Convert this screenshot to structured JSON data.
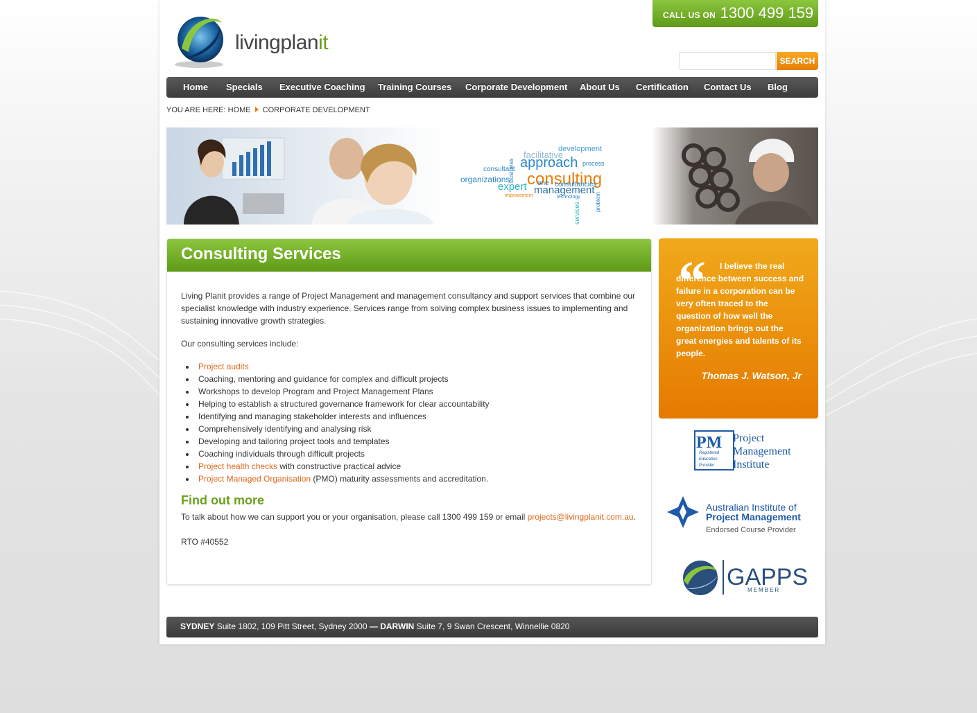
{
  "header": {
    "logo_text_main": "livingplan",
    "logo_text_accent": "it",
    "call_label": "CALL US ON",
    "call_number": "1300 499 159",
    "search_button": "SEARCH",
    "search_placeholder": ""
  },
  "nav": {
    "items": [
      {
        "label": "Home"
      },
      {
        "label": "Specials"
      },
      {
        "label": "Executive Coaching"
      },
      {
        "label": "Training Courses"
      },
      {
        "label": "Corporate Development"
      },
      {
        "label": "About Us"
      },
      {
        "label": "Certification"
      },
      {
        "label": "Contact Us"
      },
      {
        "label": "Blog"
      }
    ]
  },
  "breadcrumb": {
    "prefix": "YOU ARE HERE:",
    "home": "HOME",
    "current": "CORPORATE DEVELOPMENT"
  },
  "banner": {
    "words": [
      "development",
      "approach",
      "consulting",
      "management",
      "organizations",
      "expert",
      "consultant",
      "facilitative",
      "consultancies",
      "business",
      "process",
      "technology",
      "services",
      "improvement",
      "problem",
      "one"
    ]
  },
  "main": {
    "title": "Consulting Services",
    "intro": "Living Planit provides a range of Project Management and management consultancy and support services that combine our specialist knowledge with industry experience. Services range from solving complex business issues to implementing and sustaining innovative growth strategies.",
    "list_intro": "Our consulting services include:",
    "services": [
      {
        "link": "Project audits",
        "text": ""
      },
      {
        "link": "",
        "text": "Coaching, mentoring and guidance for complex and difficult projects"
      },
      {
        "link": "",
        "text": "Workshops to develop Program and Project Management Plans"
      },
      {
        "link": "",
        "text": "Helping to establish a structured governance framework for clear accountability"
      },
      {
        "link": "",
        "text": "Identifying and managing stakeholder interests and influences"
      },
      {
        "link": "",
        "text": "Comprehensively identifying and analysing risk"
      },
      {
        "link": "",
        "text": "Developing and tailoring project tools and templates"
      },
      {
        "link": "",
        "text": "Coaching individuals through difficult projects"
      },
      {
        "link": "Project health checks",
        "text": " with constructive practical advice"
      },
      {
        "link": "Project Managed Organisation",
        "text": " (PMO) maturity assessments and accreditation."
      }
    ],
    "find_title": "Find out more",
    "find_text": "To talk about how we can support you or your organisation, please call 1300 499 159 or email",
    "find_email": "projects@livingplanit.com.au",
    "find_end": ".",
    "rto": "RTO #40552"
  },
  "quote": {
    "text": "I believe the real difference between success and failure in a corporation can be very often traced to the question of how well the organization brings out the great energies and talents of its people.",
    "author": "Thomas J. Watson, Jr"
  },
  "partners": {
    "pmi_line1": "Project",
    "pmi_line2": "Management",
    "pmi_line3": "Institute",
    "pmi_badge1": "Registered",
    "pmi_badge2": "Education",
    "pmi_badge3": "Provider",
    "aipm_line1": "Australian Institute of",
    "aipm_line2": "Project Management",
    "aipm_line3": "Endorsed Course Provider",
    "gapps_line1": "GAPPS",
    "gapps_line2": "MEMBER"
  },
  "footer": {
    "city1": "SYDNEY",
    "addr1": "Suite 1802, 109 Pitt Street, Sydney 2000",
    "sep": "—",
    "city2": "DARWIN",
    "addr2": "Suite 7, 9 Swan Crescent, Winnellie 0820"
  },
  "colors": {
    "green": "#6aa01d",
    "orange": "#e67f0a",
    "nav_dark": "#3c3c3c",
    "link": "#e0661a"
  }
}
